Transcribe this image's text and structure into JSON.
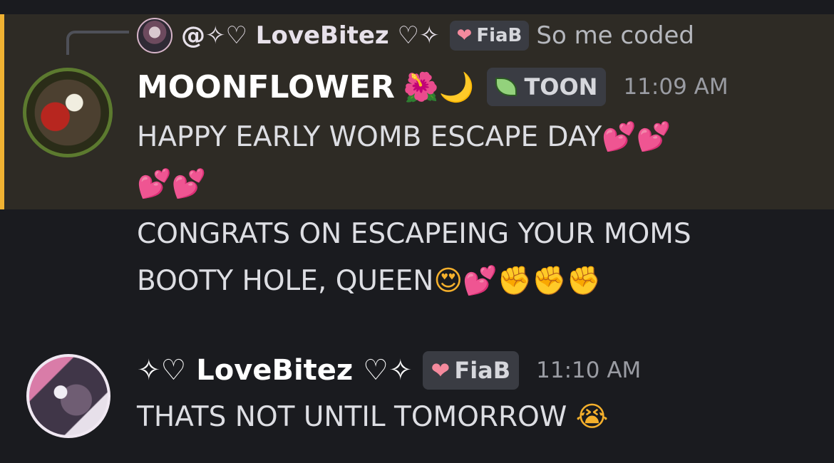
{
  "reply": {
    "username": "@✧♡ LoveBitez ♡✧",
    "tag": "FiaB",
    "preview": "So me coded"
  },
  "message1": {
    "author": "MOONFLOWER",
    "decoration": "🌺🌙",
    "tag": "TOON",
    "timestamp": "11:09 AM",
    "line1": "HAPPY EARLY WOMB ESCAPE DAY",
    "line1_emoji": "💕💕",
    "line2_emoji": "💕💕",
    "line3": "CONGRATS ON ESCAPEING YOUR MOMS",
    "line4": "BOOTY HOLE, QUEEN",
    "line4_emoji_1": "😍",
    "line4_emoji_2": "💕",
    "line4_emoji_3": "✊✊✊"
  },
  "message2": {
    "author": "✧♡ LoveBitez ♡✧",
    "tag": "FiaB",
    "timestamp": "11:10 AM",
    "text": "THATS NOT UNTIL TOMORROW",
    "emoji": "😭"
  },
  "colors": {
    "background": "#1a1b1f",
    "highlight": "#2e2b25",
    "highlight_border": "#f0b232",
    "tag_background": "#3a3c43"
  }
}
